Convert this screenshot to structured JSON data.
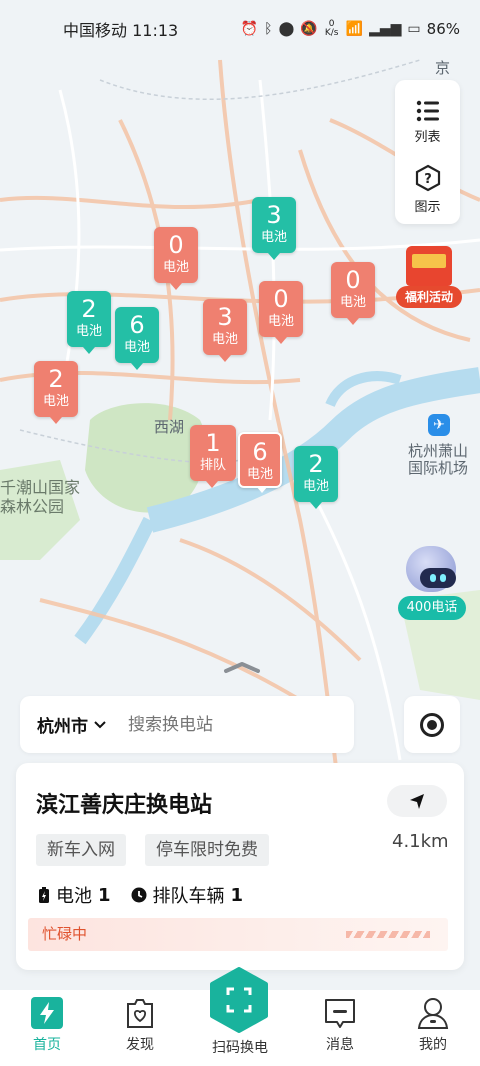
{
  "status_bar": {
    "carrier_time": "中国移动 11:13",
    "net_speed": "0 K/s",
    "battery": "86%"
  },
  "map": {
    "labels": {
      "jing": "京",
      "xihu": "西湖",
      "park": "千潮山国家\n森林公园",
      "airport": "杭州萧山\n国际机场"
    }
  },
  "side_panel": {
    "list_label": "列表",
    "legend_label": "图示"
  },
  "promo": {
    "label": "福利活动"
  },
  "service": {
    "label": "400电话"
  },
  "markers": [
    {
      "num": "0",
      "label": "电池",
      "color": "orange"
    },
    {
      "num": "3",
      "label": "电池",
      "color": "green"
    },
    {
      "num": "0",
      "label": "电池",
      "color": "orange"
    },
    {
      "num": "2",
      "label": "电池",
      "color": "green"
    },
    {
      "num": "6",
      "label": "电池",
      "color": "green"
    },
    {
      "num": "3",
      "label": "电池",
      "color": "orange"
    },
    {
      "num": "0",
      "label": "电池",
      "color": "orange"
    },
    {
      "num": "2",
      "label": "电池",
      "color": "orange"
    },
    {
      "num": "1",
      "label": "排队",
      "color": "orange"
    },
    {
      "num": "6",
      "label": "电池",
      "color": "orange"
    },
    {
      "num": "2",
      "label": "电池",
      "color": "green"
    }
  ],
  "search": {
    "city": "杭州市",
    "placeholder": "搜索换电站"
  },
  "station": {
    "name": "滨江善庆庄换电站",
    "distance": "4.1km",
    "tags": [
      "新车入网",
      "停车限时免费"
    ],
    "battery_label": "电池",
    "battery_count": "1",
    "queue_label": "排队车辆",
    "queue_count": "1",
    "status": "忙碌中"
  },
  "colors": {
    "accent": "#19b39d",
    "marker_green": "#24bfa6",
    "marker_orange": "#ef8070",
    "busy": "#e0532f"
  },
  "bottom_nav": {
    "home": "首页",
    "discover": "发现",
    "scan": "扫码换电",
    "messages": "消息",
    "me": "我的"
  }
}
